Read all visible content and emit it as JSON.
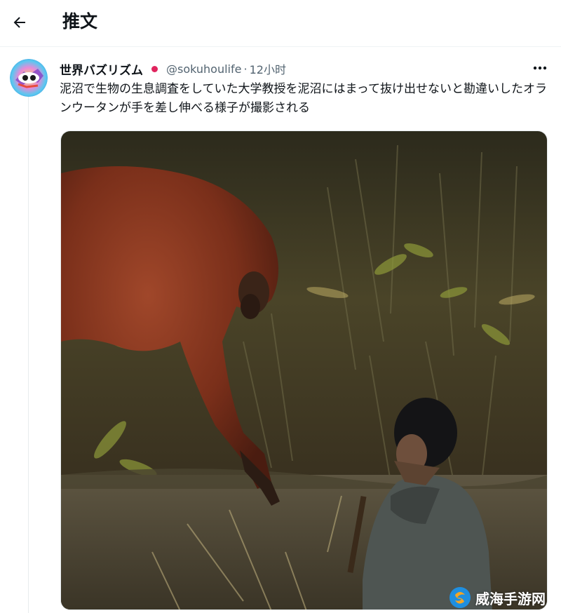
{
  "header": {
    "back_icon": "arrow-left-icon",
    "title": "推文"
  },
  "tweet": {
    "display_name": "世界バズリズム",
    "handle": "@sokuhoulife",
    "separator": "·",
    "time": "12小时",
    "more_icon": "more-horizontal-icon",
    "text": "泥沼で生物の生息調査をしていた大学教授を泥沼にはまって抜け出せないと勘違いしたオランウータンが手を差し伸べる様子が撮影される",
    "media_description": "orangutan-reaching-hand-to-man-in-water-photo"
  },
  "watermark": {
    "text": "威海手游网"
  },
  "colors": {
    "text_primary": "#0f1419",
    "text_secondary": "#536471",
    "verified_dot": "#e0245e",
    "divider": "#eff3f4"
  }
}
